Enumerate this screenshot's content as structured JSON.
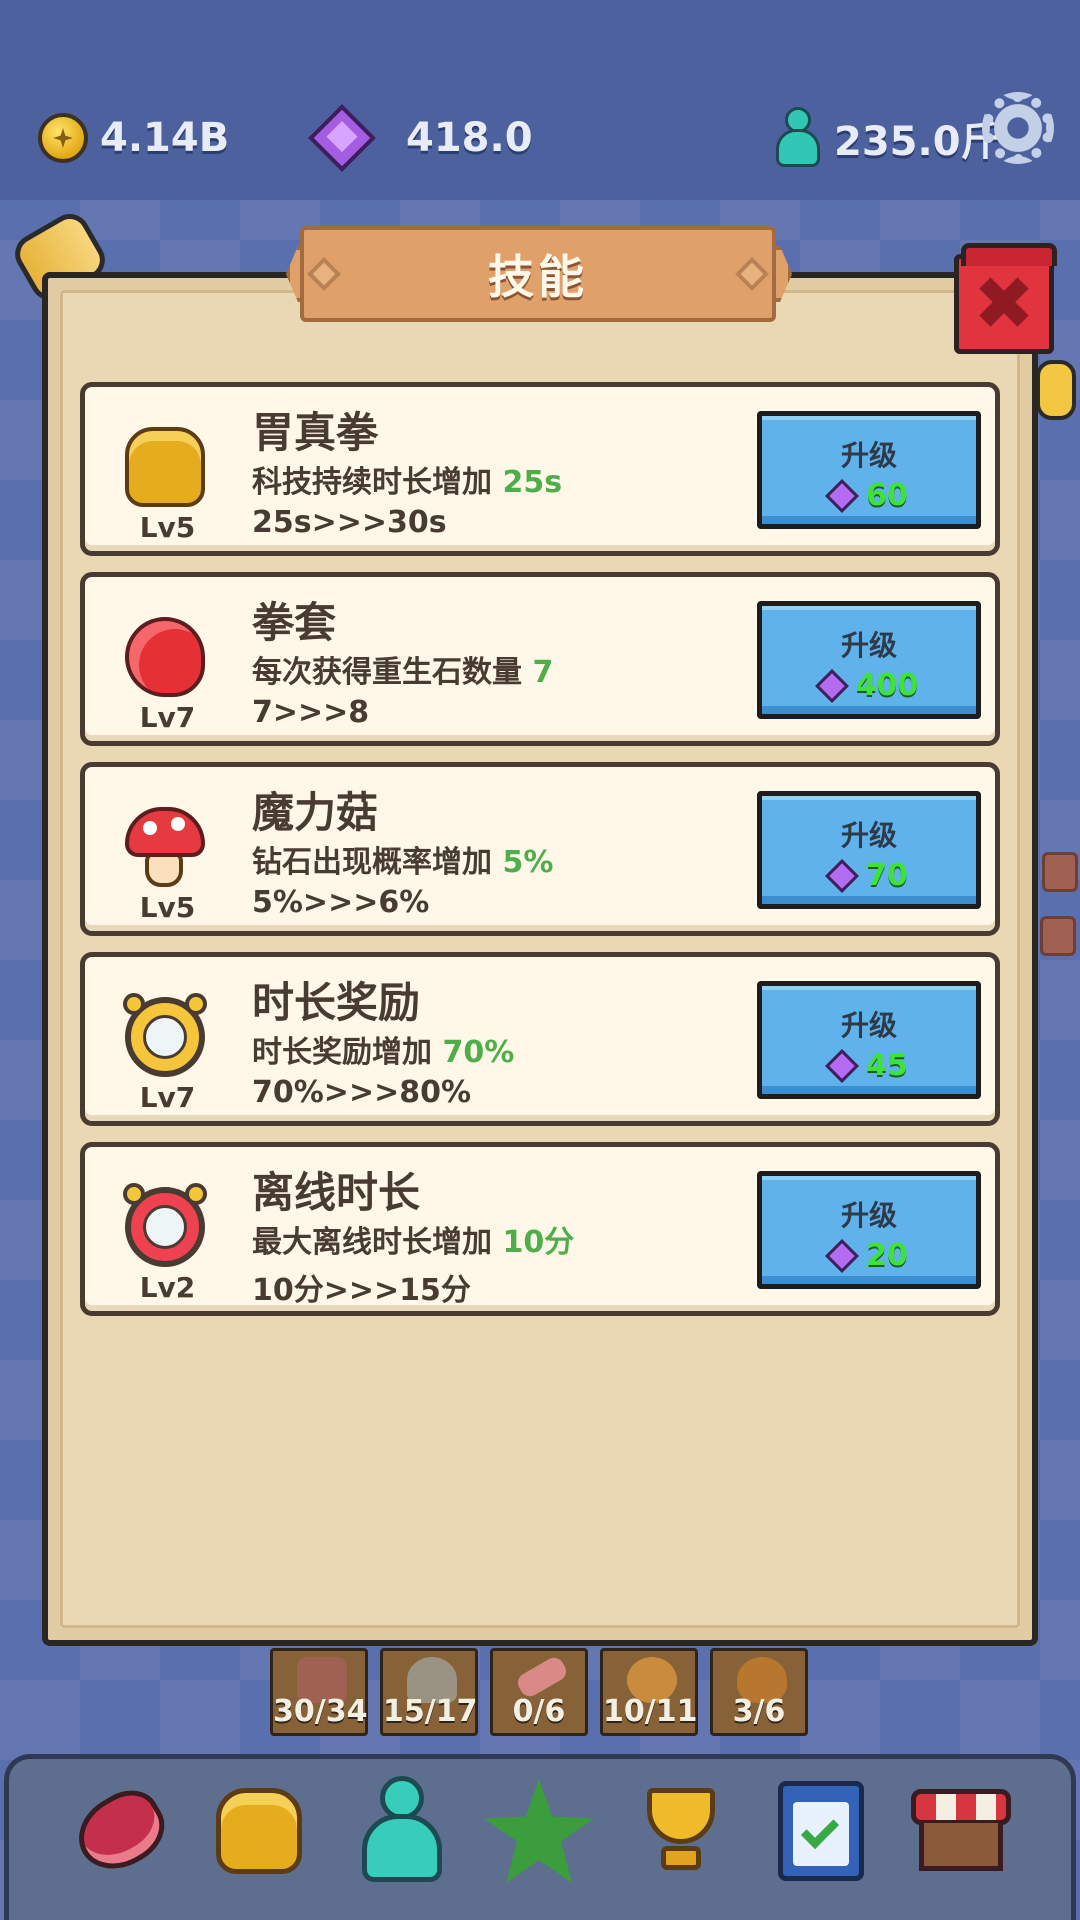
{
  "resources": {
    "coins": "4.14B",
    "gems": "418.0",
    "weight": "235.0斤"
  },
  "panel": {
    "title": "技能",
    "upgrade_label": "升级"
  },
  "skills": [
    {
      "name": "胃真拳",
      "level": "Lv5",
      "desc_prefix": "科技持续时长增加 ",
      "desc_value": "25s",
      "progress": "25s>>>30s",
      "cost": "60",
      "icon": "fist-icon"
    },
    {
      "name": "拳套",
      "level": "Lv7",
      "desc_prefix": "每次获得重生石数量 ",
      "desc_value": "7",
      "progress": "7>>>8",
      "cost": "400",
      "icon": "boxing-glove-icon"
    },
    {
      "name": "魔力菇",
      "level": "Lv5",
      "desc_prefix": "钻石出现概率增加 ",
      "desc_value": "5%",
      "progress": "5%>>>6%",
      "cost": "70",
      "icon": "mushroom-icon"
    },
    {
      "name": "时长奖励",
      "level": "Lv7",
      "desc_prefix": "时长奖励增加 ",
      "desc_value": "70%",
      "progress": "70%>>>80%",
      "cost": "45",
      "icon": "gold-clock-icon"
    },
    {
      "name": "离线时长",
      "level": "Lv2",
      "desc_prefix": "最大离线时长增加 ",
      "desc_value": "10分",
      "progress": "10分>>>15分",
      "cost": "20",
      "icon": "red-clock-icon"
    }
  ],
  "inventory": [
    {
      "count": "30/34",
      "icon": "crate-icon"
    },
    {
      "count": "15/17",
      "icon": "stone-icon"
    },
    {
      "count": "0/6",
      "icon": "meat-strip-icon"
    },
    {
      "count": "10/11",
      "icon": "bowl-icon"
    },
    {
      "count": "3/6",
      "icon": "roast-chicken-icon"
    }
  ],
  "nav": [
    "meat-icon",
    "fist-icon",
    "character-icon",
    "star-icon",
    "trophy-icon",
    "clipboard-icon",
    "shop-icon"
  ],
  "colors": {
    "background": "#5a6fae",
    "panel": "#ead8b4",
    "row": "#fff8e9",
    "upgrade_button": "#5fb2ea",
    "highlight_green": "#4fae4a",
    "cost_green": "#3ee23a",
    "close_red": "#e2343f"
  }
}
